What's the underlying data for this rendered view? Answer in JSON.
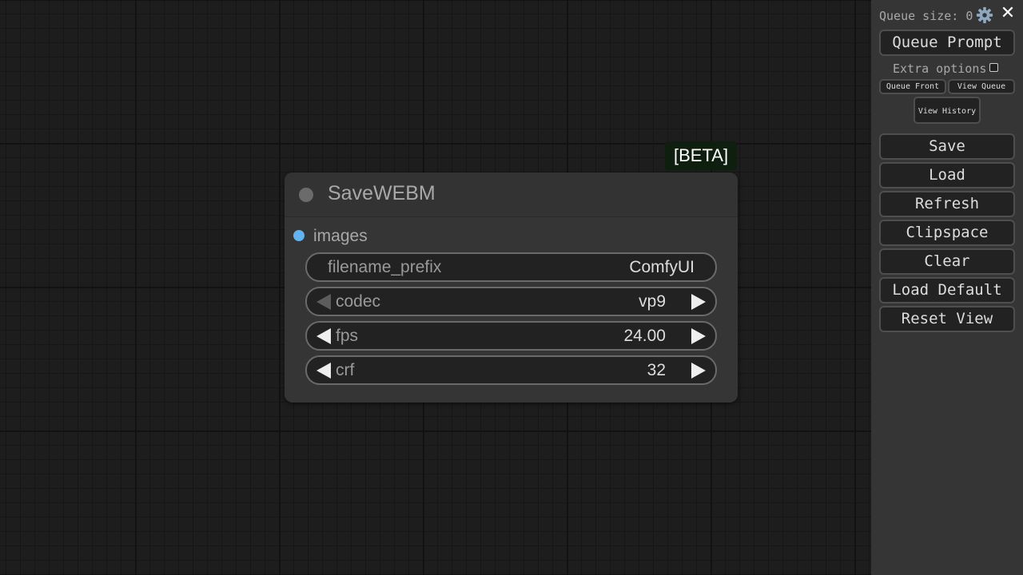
{
  "node": {
    "badge": "[BETA]",
    "title": "SaveWEBM",
    "input_slot": "images",
    "widgets": {
      "filename_prefix": {
        "label": "filename_prefix",
        "value": "ComfyUI"
      },
      "codec": {
        "label": "codec",
        "value": "vp9"
      },
      "fps": {
        "label": "fps",
        "value": "24.00"
      },
      "crf": {
        "label": "crf",
        "value": "32"
      }
    }
  },
  "panel": {
    "queue_size": "Queue size: 0",
    "queue_prompt": "Queue Prompt",
    "extra_options": "Extra options",
    "queue_front": "Queue Front",
    "view_queue": "View Queue",
    "view_history": "View History",
    "buttons": {
      "save": "Save",
      "load": "Load",
      "refresh": "Refresh",
      "clipspace": "Clipspace",
      "clear": "Clear",
      "load_default": "Load Default",
      "reset_view": "Reset View"
    }
  },
  "icons": {
    "settings": "gear-icon",
    "close": "close-icon"
  },
  "colors": {
    "slot_images": "#62b3f0",
    "badge_bg": "#0f1f0f"
  }
}
